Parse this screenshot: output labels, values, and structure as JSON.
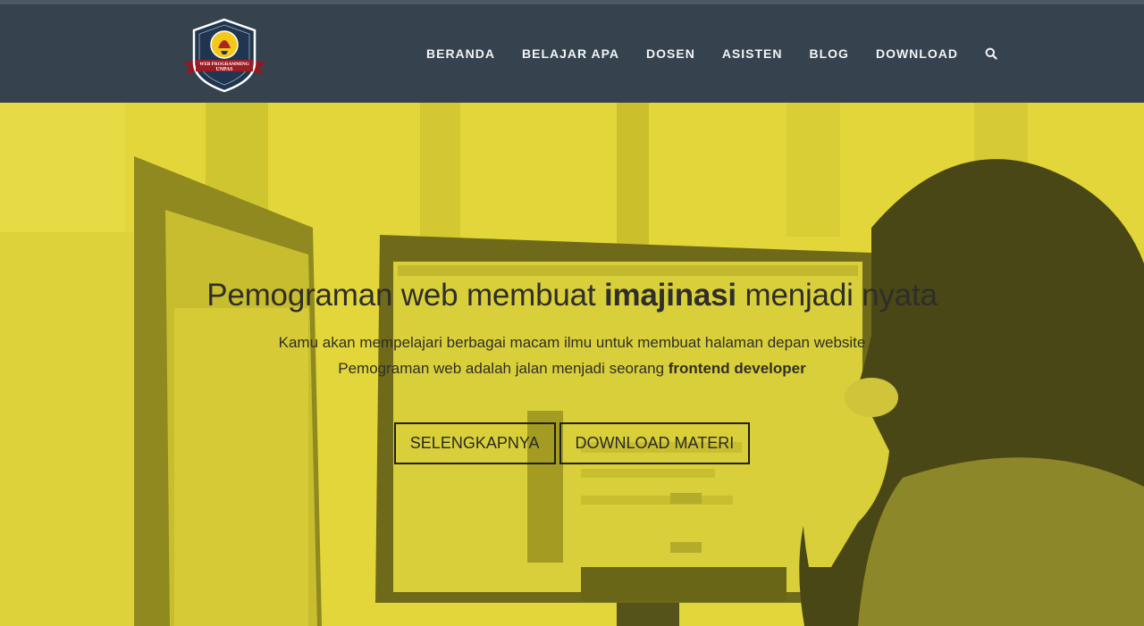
{
  "logo": {
    "text_line1": "WEB PROGRAMMING",
    "text_line2": "UNPAS",
    "colors": {
      "shield": "#1f3550",
      "border": "#ffffff",
      "ribbon": "#9c1c24",
      "emblem": "#f2c81c"
    }
  },
  "nav": {
    "items": [
      {
        "label": "BERANDA"
      },
      {
        "label": "BELAJAR APA"
      },
      {
        "label": "DOSEN"
      },
      {
        "label": "ASISTEN"
      },
      {
        "label": "BLOG"
      },
      {
        "label": "DOWNLOAD"
      }
    ],
    "search_icon": "search-icon"
  },
  "hero": {
    "headline_before": "Pemograman web membuat ",
    "headline_bold": "imajinasi",
    "headline_after": " menjadi nyata",
    "line1": "Kamu akan mempelajari berbagai macam ilmu untuk membuat halaman depan website",
    "line2_before": "Pemograman web adalah jalan menjadi seorang ",
    "line2_bold": "frontend developer",
    "button_primary": "SELENGKAPNYA",
    "button_secondary": "DOWNLOAD MATERI",
    "overlay_color": "#e8dc3a"
  },
  "colors": {
    "header_bg": "#36434f",
    "nav_text": "#f2f4f6"
  }
}
